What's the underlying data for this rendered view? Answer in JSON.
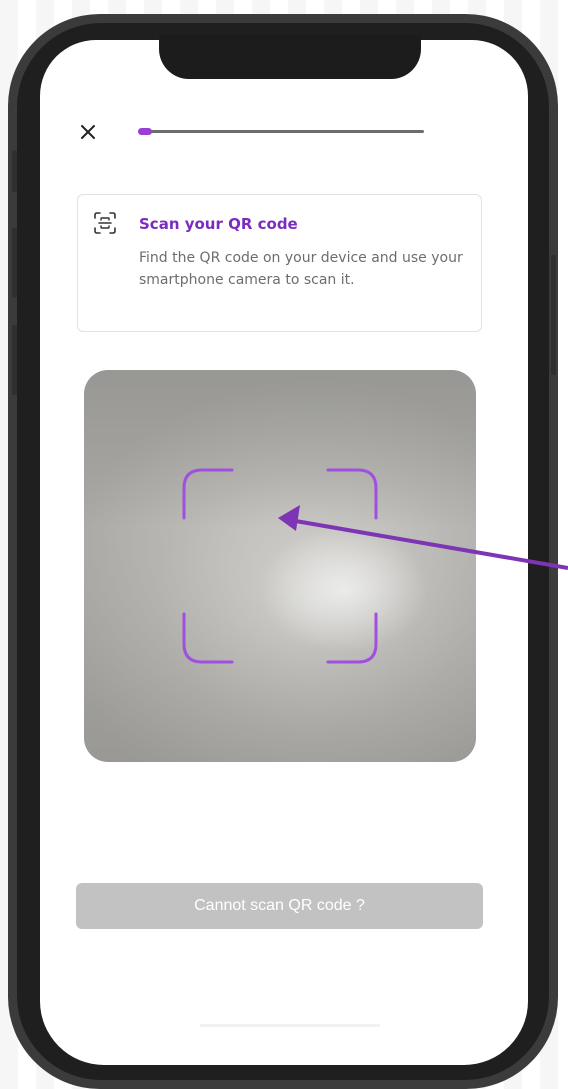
{
  "header": {
    "close_icon": "close-icon",
    "progress_fraction": 0.05
  },
  "info_card": {
    "icon": "scan-frame-icon",
    "title": "Scan your QR code",
    "description": "Find the QR code on your device and use your smartphone camera to scan it."
  },
  "scanner": {
    "frame_color": "#a14fe0"
  },
  "annotation": {
    "arrow_color": "#7d35b5"
  },
  "footer": {
    "cannot_scan_label": "Cannot scan QR code ?"
  },
  "colors": {
    "accent": "#9c3ed3",
    "title": "#7b2cbf",
    "button_disabled": "#c2c2c2"
  }
}
